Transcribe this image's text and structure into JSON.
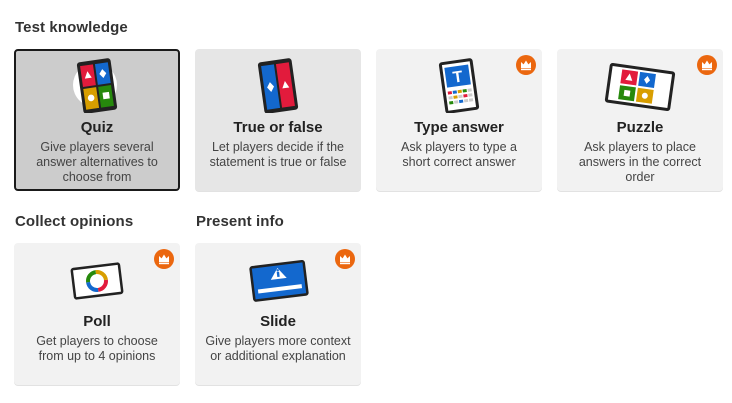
{
  "sections": {
    "test_knowledge": "Test knowledge",
    "collect_opinions": "Collect opinions",
    "present_info": "Present info"
  },
  "cards": {
    "quiz": {
      "title": "Quiz",
      "desc": "Give players several answer alternatives to choose from",
      "premium": false,
      "state": "selected"
    },
    "true_false": {
      "title": "True or false",
      "desc": "Let players decide if the statement is true or false",
      "premium": false,
      "state": "hovered"
    },
    "type_answer": {
      "title": "Type answer",
      "desc": "Ask players to type a short correct answer",
      "premium": true
    },
    "puzzle": {
      "title": "Puzzle",
      "desc": "Ask players to place answers in the correct order",
      "premium": true
    },
    "poll": {
      "title": "Poll",
      "desc": "Get players to choose from up to 4 opinions",
      "premium": true
    },
    "slide": {
      "title": "Slide",
      "desc": "Give players more context or additional explanation",
      "premium": true
    }
  },
  "colors": {
    "red": "#e21b3c",
    "blue": "#1368ce",
    "yellow": "#d89e00",
    "green": "#26890c",
    "premium": "#eb670f"
  }
}
